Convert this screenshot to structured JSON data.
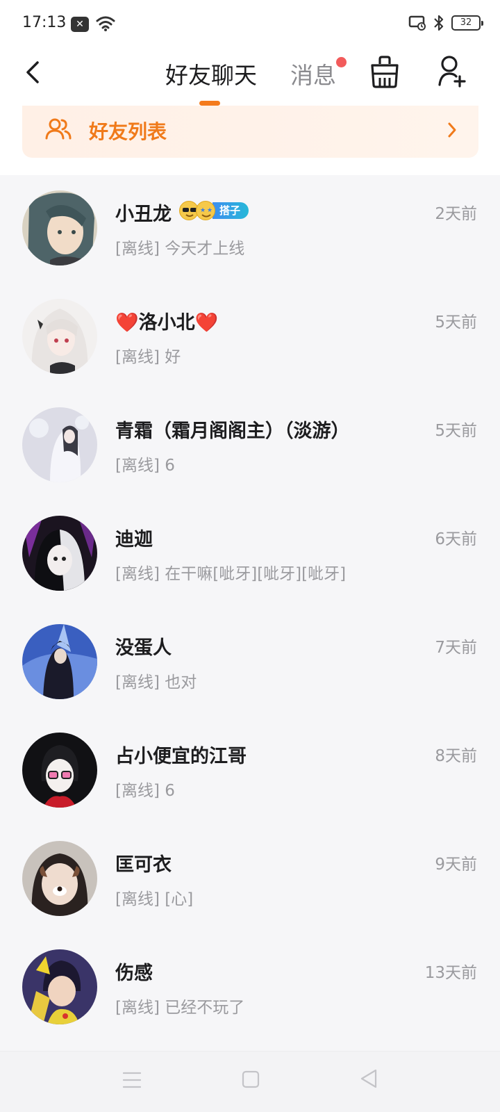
{
  "status_bar": {
    "time": "17:13",
    "battery": "32",
    "notification_icon": "close-box-icon",
    "icons": [
      "wifi-icon",
      "screen-cast-icon",
      "bluetooth-icon",
      "battery-icon"
    ]
  },
  "header": {
    "tab_friends": "好友聊天",
    "tab_messages": "消息",
    "accent": "#f47b1c",
    "unread_dot_color": "#f25b5b",
    "icons": [
      "back-icon",
      "clean-basket-icon",
      "add-friend-icon"
    ]
  },
  "banner": {
    "label": "好友列表",
    "icons": [
      "friends-icon",
      "chevron-right-icon"
    ]
  },
  "chats": [
    {
      "name": "小丑龙",
      "preview": "[离线] 今天才上线",
      "time": "2天前",
      "badge": "搭子"
    },
    {
      "name": "❤️洛小北❤️",
      "preview": "[离线] 好",
      "time": "5天前"
    },
    {
      "name": "青霜（霜月阁阁主）（淡游）",
      "preview": "[离线] 6",
      "time": "5天前"
    },
    {
      "name": "迪迦",
      "preview": "[离线] 在干嘛[呲牙][呲牙][呲牙]",
      "time": "6天前"
    },
    {
      "name": "没蛋人",
      "preview": "[离线] 也对",
      "time": "7天前"
    },
    {
      "name": "占小便宜的江哥",
      "preview": "[离线] 6",
      "time": "8天前"
    },
    {
      "name": "匡可衣",
      "preview": "[离线] [心]",
      "time": "9天前"
    },
    {
      "name": "伤感",
      "preview": "[离线] 已经不玩了",
      "time": "13天前"
    }
  ],
  "navbar": {
    "icons": [
      "menu-icon",
      "home-square-icon",
      "back-triangle-icon"
    ]
  }
}
